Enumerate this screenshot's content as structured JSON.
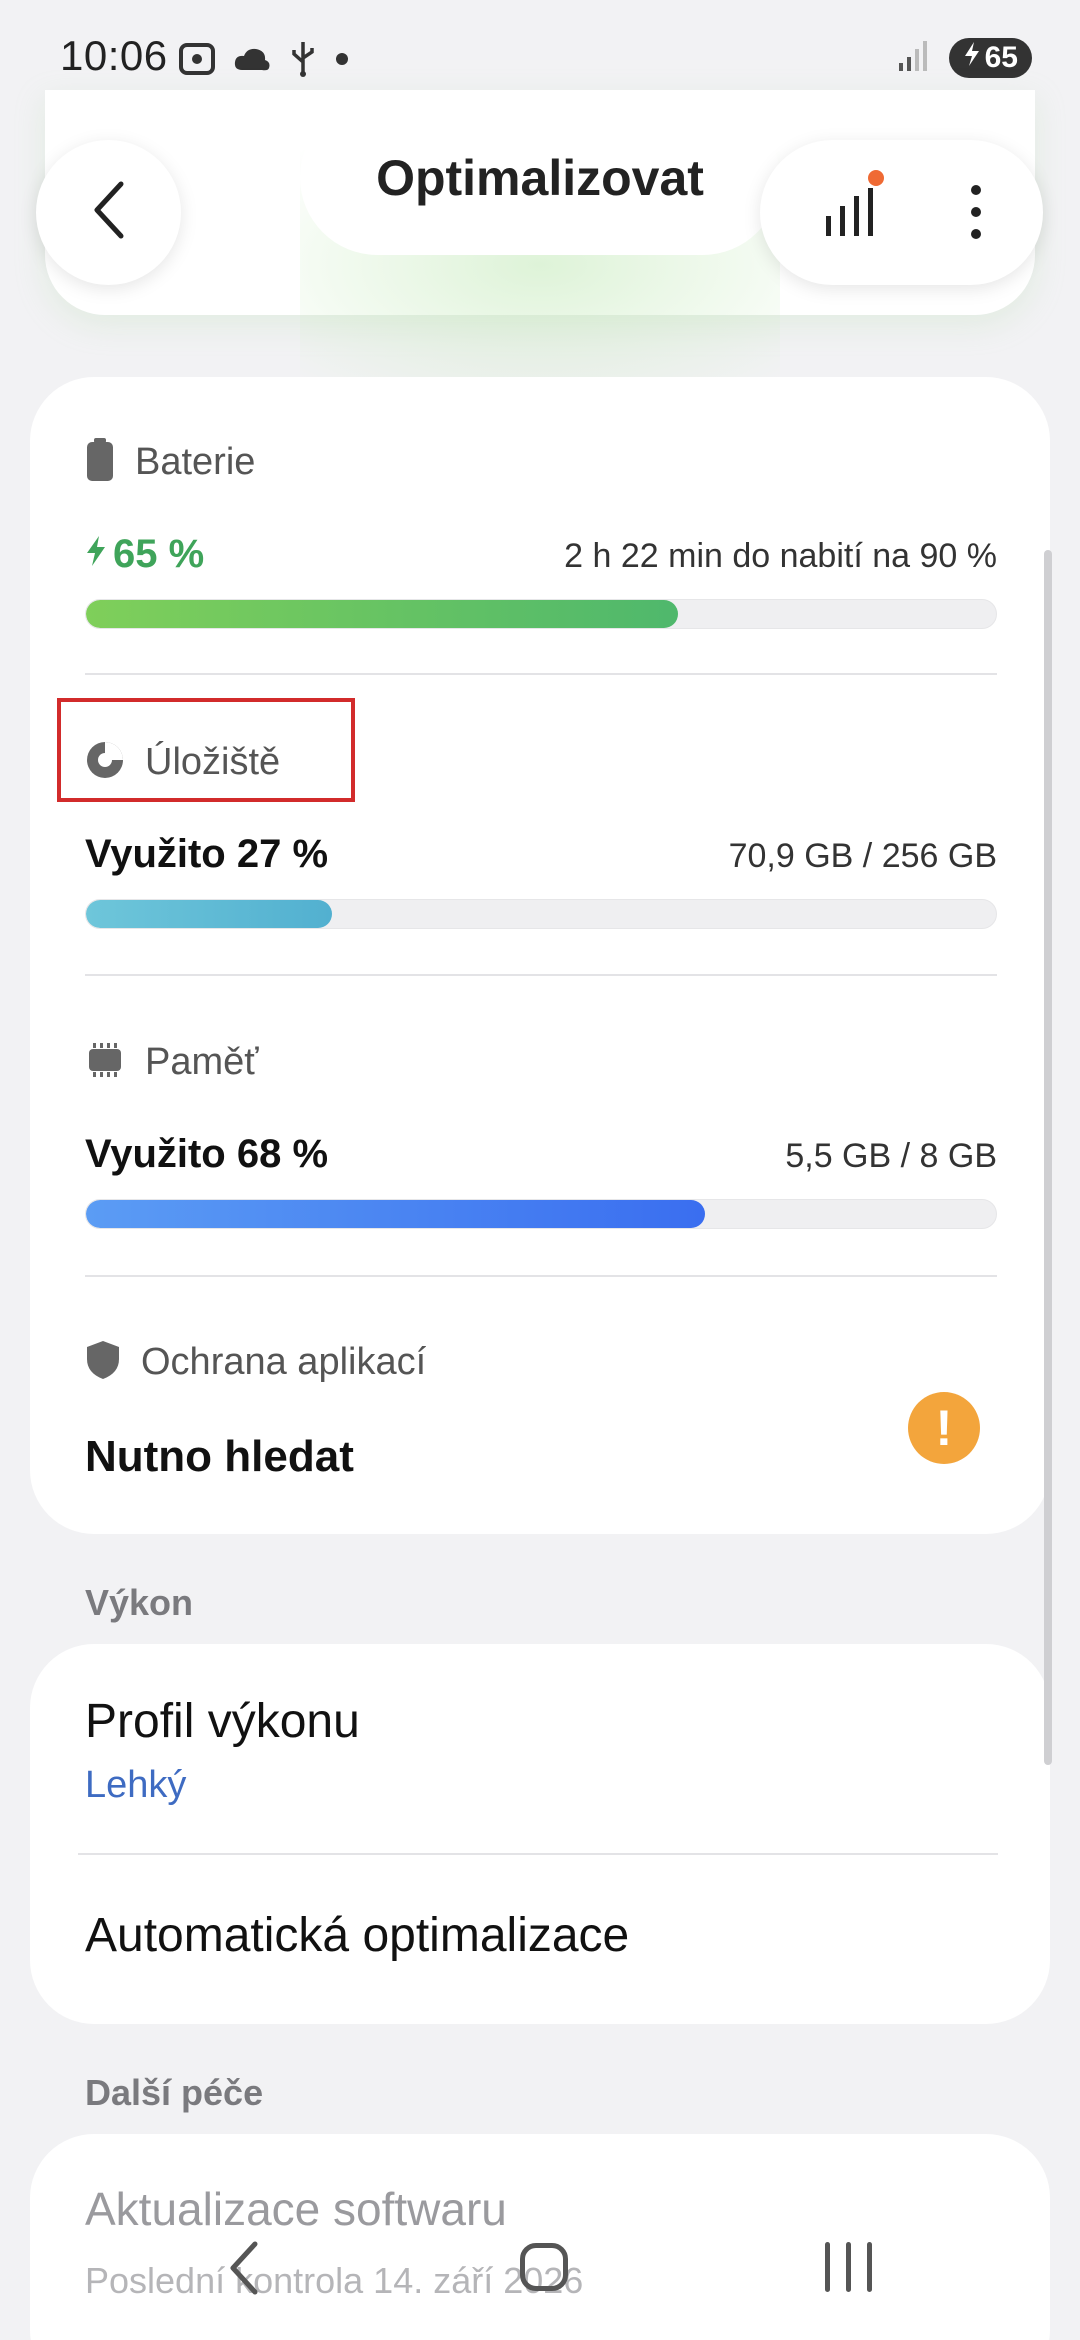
{
  "status_bar": {
    "time": "10:06",
    "battery": "65",
    "icons": [
      "screenshot-icon",
      "cloud-icon",
      "usb-icon",
      "dot-icon",
      "signal-icon",
      "charging-icon"
    ]
  },
  "header": {
    "title": "Optimalizovat",
    "back_icon": "chevron-left-icon",
    "actions": [
      "stats-icon",
      "more-options-icon"
    ]
  },
  "battery": {
    "label": "Baterie",
    "value": "65 %",
    "detail": "2 h 22 min do nabití na 90 %",
    "fraction": 0.65,
    "color": "#5cbf6a"
  },
  "storage": {
    "label": "Úložiště",
    "value": "Využito 27 %",
    "detail": "70,9 GB / 256 GB",
    "fraction": 0.27,
    "color": "#5ab9d6"
  },
  "memory": {
    "label": "Paměť",
    "value": "Využito 68 %",
    "detail": "5,5 GB / 8 GB",
    "fraction": 0.68,
    "color": "#3f7ef0"
  },
  "app_protection": {
    "label": "Ochrana aplikací",
    "status": "Nutno hledat",
    "badge": "!"
  },
  "performance_group": {
    "label": "Výkon",
    "profile_title": "Profil výkonu",
    "profile_value": "Lehký",
    "auto_optimize": "Automatická optimalizace"
  },
  "care_group": {
    "label": "Další péče",
    "software_update": "Aktualizace softwaru",
    "last_check": "Poslední kontrola 14. září 2026"
  }
}
